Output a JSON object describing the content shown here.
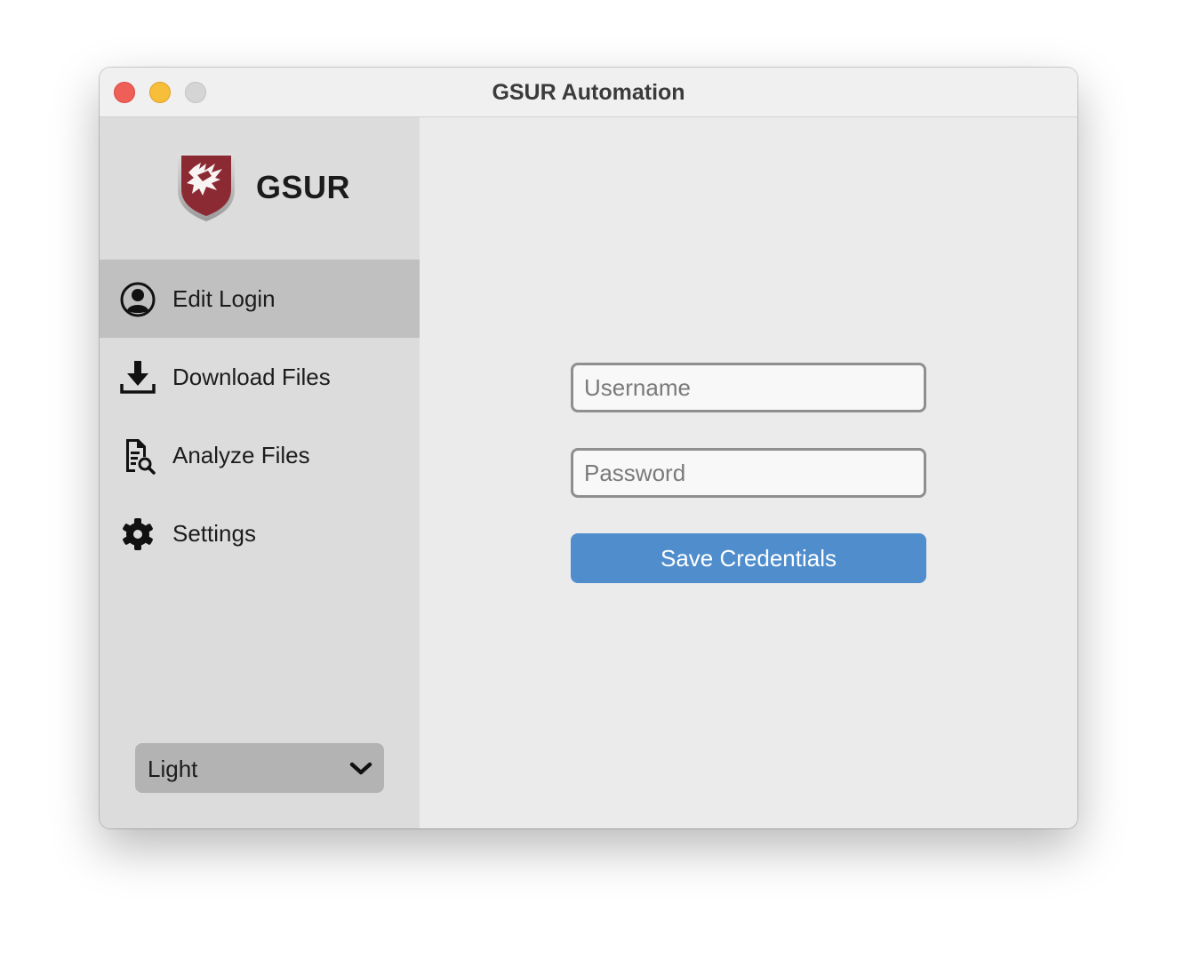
{
  "window": {
    "title": "GSUR Automation"
  },
  "sidebar": {
    "logo": {
      "text": "GSUR",
      "icon": "wsu-cougar-shield-icon",
      "color": "#8c2a33"
    },
    "items": [
      {
        "label": "Edit Login",
        "icon": "user-circle-icon",
        "active": true
      },
      {
        "label": "Download Files",
        "icon": "download-icon",
        "active": false
      },
      {
        "label": "Analyze Files",
        "icon": "file-search-icon",
        "active": false
      },
      {
        "label": "Settings",
        "icon": "gear-icon",
        "active": false
      }
    ],
    "theme_selector": {
      "value": "Light"
    }
  },
  "login_form": {
    "username_placeholder": "Username",
    "password_placeholder": "Password",
    "save_label": "Save Credentials"
  },
  "colors": {
    "accent": "#4f8dcc",
    "sidebar_active": "#c0c0c0",
    "sidebar_bg": "#dcdcdc",
    "main_bg": "#ebebeb"
  }
}
